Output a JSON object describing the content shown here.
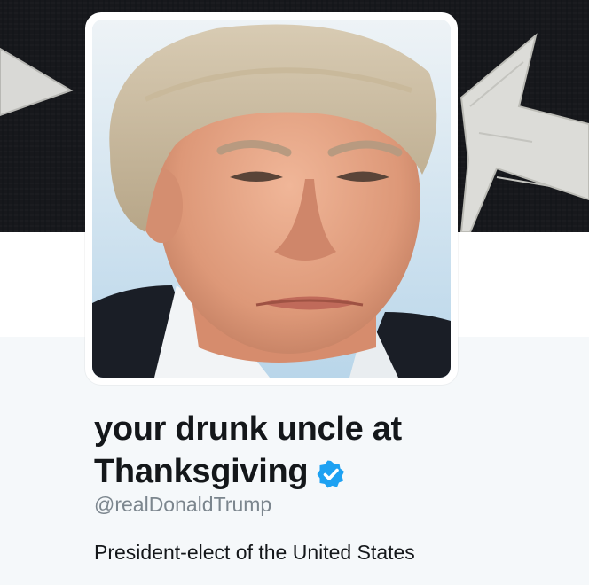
{
  "profile": {
    "display_name_line1": "your drunk uncle at",
    "display_name_line2": "Thanksgiving",
    "handle": "@realDonaldTrump",
    "bio": "President-elect of the United States",
    "verified": true
  },
  "icons": {
    "verified": "verified-badge-icon",
    "banner": "star-flag-banner"
  },
  "colors": {
    "verified_blue": "#1da1f2",
    "name_text": "#14171a",
    "handle_text": "#7c868e",
    "page_bg": "#f5f8fa",
    "banner_bg": "#15161a"
  }
}
